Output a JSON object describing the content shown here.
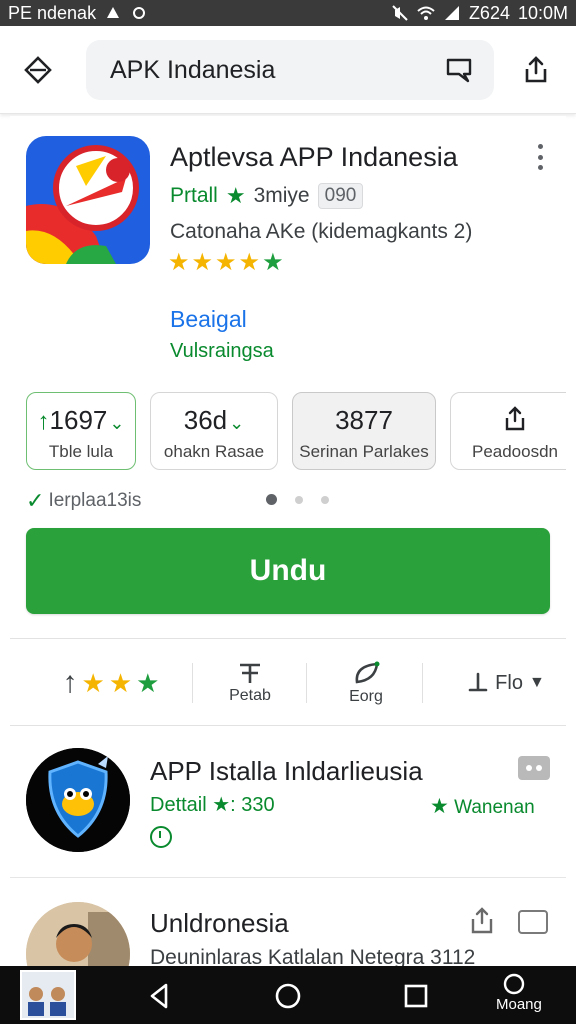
{
  "status_bar": {
    "left_text": "PE ndenak",
    "time_text": "10:0M",
    "battery_text": "Z624"
  },
  "header": {
    "search_value": "APK Indanesia"
  },
  "app": {
    "title": "Aptlevsa APP Indanesia",
    "developer": "Prtall",
    "developer_sub": "3miye",
    "badge": "090",
    "subtitle": "Catonaha AKe (kidemagkants 2)",
    "link_blue": "Beaigal",
    "link_green": "Vulsraingsa",
    "rating_stars": 4.5
  },
  "stats": [
    {
      "value": "1697",
      "label": "Tble lula"
    },
    {
      "value": "36d",
      "label": "ohakn Rasae"
    },
    {
      "value": "3877",
      "label": "Serinan Parlakes"
    },
    {
      "value": "",
      "label": "Peadoosdn"
    }
  ],
  "verified_text": "Ierplaa13is",
  "install_label": "Undu",
  "actions": {
    "rate_label": "Petab",
    "eco_label": "Eorg",
    "filter_label": "Flo"
  },
  "list": [
    {
      "title": "APP Istalla Inldarlieusia",
      "meta": "Dettail ★: 330",
      "right": "Wanenan"
    },
    {
      "title": "Unldronesia",
      "sub": "Deuninlaras Katlalan Netegra 3112"
    }
  ],
  "nav": {
    "label": "Moang"
  },
  "colors": {
    "accent_green": "#2aa13b",
    "brand_blue": "#1a73e8",
    "status_bar_bg": "#3a3a3a",
    "nav_bar_bg": "#0d0d0d"
  }
}
